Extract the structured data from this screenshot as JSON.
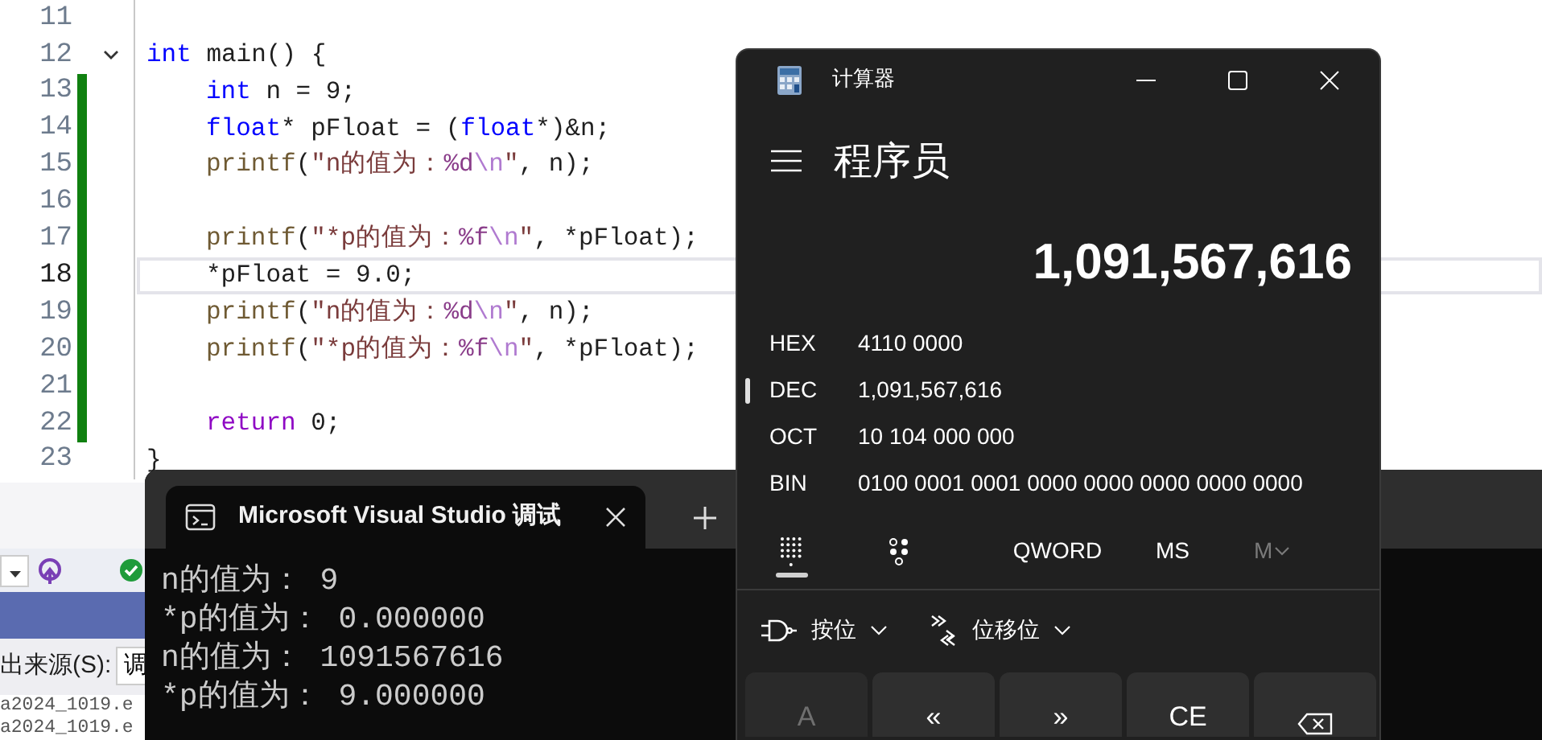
{
  "editor": {
    "lines": [
      {
        "number": "11",
        "current": false,
        "changed": false
      },
      {
        "number": "12",
        "current": false,
        "changed": false,
        "indented": false,
        "fold": {
          "expanded": true
        },
        "tokens": [
          {
            "kind": "kw",
            "t": "int"
          },
          {
            "kind": "txt",
            "t": " main() {"
          }
        ]
      },
      {
        "number": "13",
        "current": false,
        "changed": true,
        "indented": true,
        "tokens": [
          {
            "kind": "kw",
            "t": "int"
          },
          {
            "kind": "txt",
            "t": " n = 9;"
          }
        ]
      },
      {
        "number": "14",
        "current": false,
        "changed": true,
        "indented": true,
        "tokens": [
          {
            "kind": "kw",
            "t": "float"
          },
          {
            "kind": "txt",
            "t": "* pFloat = ("
          },
          {
            "kind": "kw",
            "t": "float"
          },
          {
            "kind": "txt",
            "t": "*)&n;"
          }
        ]
      },
      {
        "number": "15",
        "current": false,
        "changed": true,
        "indented": true,
        "tokens": [
          {
            "kind": "fn",
            "t": "printf"
          },
          {
            "kind": "txt",
            "t": "("
          },
          {
            "kind": "str",
            "t": "\"n的值为："
          },
          {
            "kind": "fmt",
            "t": "%d"
          },
          {
            "kind": "esc",
            "t": "\\n"
          },
          {
            "kind": "str",
            "t": "\""
          },
          {
            "kind": "txt",
            "t": ", n);"
          }
        ]
      },
      {
        "number": "16",
        "current": false,
        "changed": true
      },
      {
        "number": "17",
        "current": false,
        "changed": true,
        "indented": true,
        "tokens": [
          {
            "kind": "fn",
            "t": "printf"
          },
          {
            "kind": "txt",
            "t": "("
          },
          {
            "kind": "str",
            "t": "\"*p的值为："
          },
          {
            "kind": "fmt",
            "t": "%f"
          },
          {
            "kind": "esc",
            "t": "\\n"
          },
          {
            "kind": "str",
            "t": "\""
          },
          {
            "kind": "txt",
            "t": ", *pFloat);"
          }
        ]
      },
      {
        "number": "18",
        "current": true,
        "changed": true,
        "indented": true,
        "tokens": [
          {
            "kind": "txt",
            "t": "*pFloat = 9.0;"
          }
        ]
      },
      {
        "number": "19",
        "current": false,
        "changed": true,
        "indented": true,
        "tokens": [
          {
            "kind": "fn",
            "t": "printf"
          },
          {
            "kind": "txt",
            "t": "("
          },
          {
            "kind": "str",
            "t": "\"n的值为："
          },
          {
            "kind": "fmt",
            "t": "%d"
          },
          {
            "kind": "esc",
            "t": "\\n"
          },
          {
            "kind": "str",
            "t": "\""
          },
          {
            "kind": "txt",
            "t": ", n);"
          }
        ]
      },
      {
        "number": "20",
        "current": false,
        "changed": true,
        "indented": true,
        "tokens": [
          {
            "kind": "fn",
            "t": "printf"
          },
          {
            "kind": "txt",
            "t": "("
          },
          {
            "kind": "str",
            "t": "\"*p的值为："
          },
          {
            "kind": "fmt",
            "t": "%f"
          },
          {
            "kind": "esc",
            "t": "\\n"
          },
          {
            "kind": "str",
            "t": "\""
          },
          {
            "kind": "txt",
            "t": ", *pFloat);"
          }
        ]
      },
      {
        "number": "21",
        "current": false,
        "changed": true
      },
      {
        "number": "22",
        "current": false,
        "changed": true,
        "indented": true,
        "tokens": [
          {
            "kind": "ctl",
            "t": "return"
          },
          {
            "kind": "txt",
            "t": " 0;"
          }
        ]
      },
      {
        "number": "23",
        "current": false,
        "changed": false,
        "indented": false,
        "tokens": [
          {
            "kind": "txt",
            "t": "}"
          }
        ]
      }
    ]
  },
  "vs_panel": {
    "source_label": "出来源(S):",
    "source_value": "调",
    "files": [
      "a2024_1019.e",
      "a2024_1019.e"
    ]
  },
  "terminal": {
    "tab_title": "Microsoft Visual Studio 调试",
    "output": [
      "n的值为： 9",
      "*p的值为： 0.000000",
      "n的值为： 1091567616",
      "*p的值为： 9.000000"
    ]
  },
  "calculator": {
    "title": "计算器",
    "mode": "程序员",
    "display": "1,091,567,616",
    "radix": [
      {
        "label": "HEX",
        "value": "4110 0000",
        "selected": false
      },
      {
        "label": "DEC",
        "value": "1,091,567,616",
        "selected": true
      },
      {
        "label": "OCT",
        "value": "10 104 000 000",
        "selected": false
      },
      {
        "label": "BIN",
        "value": "0100 0001 0001 0000 0000 0000 0000 0000",
        "selected": false
      }
    ],
    "keypad_tabs": [
      {
        "kind": "keypad",
        "selected": true
      },
      {
        "kind": "bits",
        "selected": false
      }
    ],
    "word_size": "QWORD",
    "memory": [
      {
        "label": "MS",
        "disabled": false,
        "dropdown": false
      },
      {
        "label": "M",
        "disabled": true,
        "dropdown": true
      }
    ],
    "operators": [
      {
        "kind": "bitwise",
        "label": "按位"
      },
      {
        "kind": "shift",
        "label": "位移位"
      }
    ],
    "keys": [
      {
        "kind": "text",
        "label": "A",
        "disabled": true
      },
      {
        "kind": "text",
        "label": "«",
        "disabled": false
      },
      {
        "kind": "text",
        "label": "»",
        "disabled": false
      },
      {
        "kind": "text",
        "label": "CE",
        "disabled": false
      },
      {
        "kind": "backspace",
        "disabled": false
      }
    ]
  }
}
